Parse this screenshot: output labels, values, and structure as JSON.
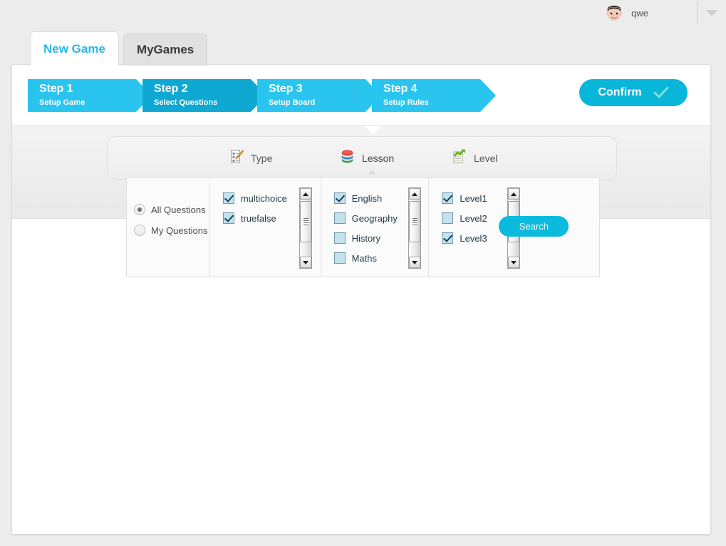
{
  "header": {
    "username": "qwe",
    "avatar_icon": "user-avatar-face",
    "caret_icon": "chevron-down-icon"
  },
  "tabs": [
    {
      "label": "New Game",
      "active": true
    },
    {
      "label": "MyGames",
      "active": false
    }
  ],
  "steps": [
    {
      "title": "Step 1",
      "sub": "Setup Game",
      "current": false
    },
    {
      "title": "Step 2",
      "sub": "Select Questions",
      "current": true
    },
    {
      "title": "Step 3",
      "sub": "Setup Board",
      "current": false
    },
    {
      "title": "Step 4",
      "sub": "Setup Rules",
      "current": false
    }
  ],
  "confirm": {
    "label": "Confirm",
    "icon": "check-icon"
  },
  "shelf": {
    "items": [
      {
        "label": "Type",
        "icon": "note-pencil-icon",
        "active": false
      },
      {
        "label": "Lesson",
        "icon": "books-stack-icon",
        "active": true
      },
      {
        "label": "Level",
        "icon": "chart-arrow-icon",
        "active": false
      }
    ],
    "collapse_caret": "⌃"
  },
  "filters": {
    "scope": {
      "options": [
        {
          "label": "All Questions",
          "checked": true
        },
        {
          "label": "My Questions",
          "checked": false
        }
      ]
    },
    "type_list": [
      {
        "label": "multichoice",
        "checked": true
      },
      {
        "label": "truefalse",
        "checked": true
      }
    ],
    "lesson_list": [
      {
        "label": "English",
        "checked": true
      },
      {
        "label": "Geography",
        "checked": false
      },
      {
        "label": "History",
        "checked": false
      },
      {
        "label": "Maths",
        "checked": false
      }
    ],
    "level_list": [
      {
        "label": "Level1",
        "checked": true
      },
      {
        "label": "Level2",
        "checked": false
      },
      {
        "label": "Level3",
        "checked": true
      }
    ],
    "search_label": "Search"
  },
  "colors": {
    "accent": "#29c5ee",
    "accent_dark": "#0fa8d2",
    "button": "#08b6da",
    "tab_active_text": "#29b8e8",
    "page_bg": "#ececec"
  }
}
